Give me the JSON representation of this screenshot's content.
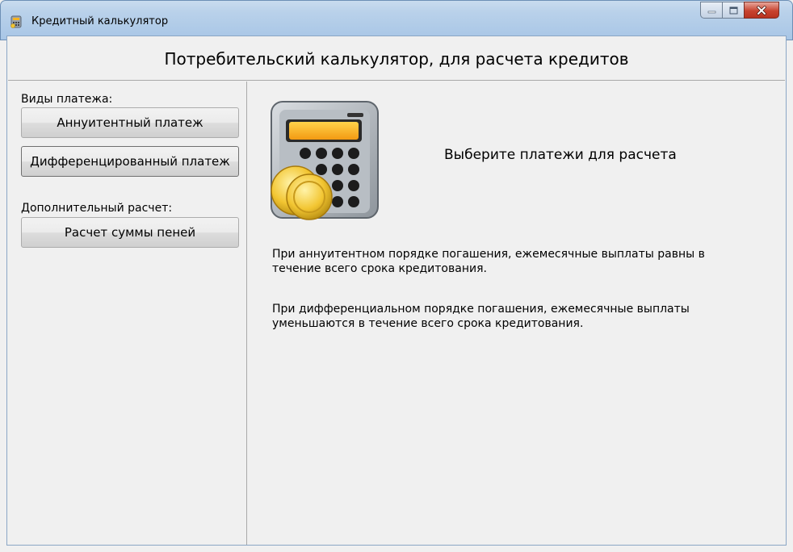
{
  "window": {
    "title": "Кредитный калькулятор",
    "colors": {
      "titlebar": "#b9d1ea",
      "close_button": "#c8432f",
      "client_bg": "#f0f0f0"
    }
  },
  "header": {
    "title": "Потребительский калькулятор, для расчета кредитов"
  },
  "sidebar": {
    "payment_types_label": "Виды платежа:",
    "annuity_button": "Аннуитентный платеж",
    "differentiated_button": "Дифференцированный платеж",
    "additional_label": "Дополнительный расчет:",
    "penalty_button": "Расчет суммы пеней"
  },
  "main": {
    "icon": "calculator-with-coins-icon",
    "prompt": "Выберите платежи для расчета",
    "annuity_info_line1": "При аннуитентном порядке погашения, ежемесячные выплаты равны в",
    "annuity_info_line2": "течение всего срока кредитования.",
    "diff_info_line1": "При дифференциальном порядке погашения, ежемесячные выплаты",
    "diff_info_line2": "уменьшаются в течение всего срока кредитования."
  }
}
